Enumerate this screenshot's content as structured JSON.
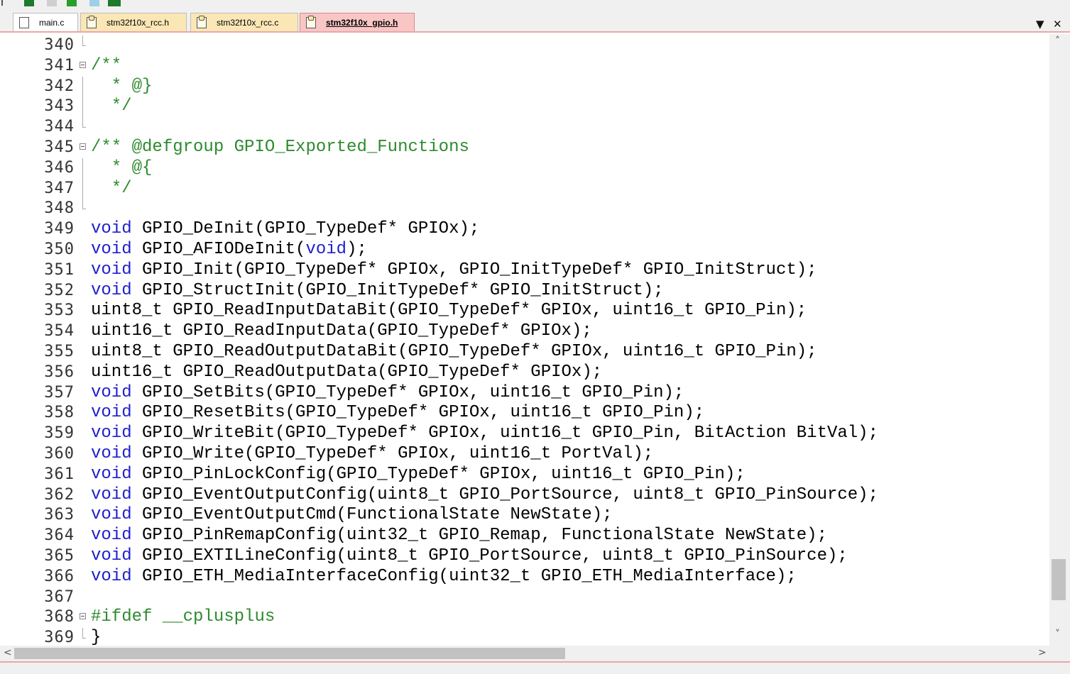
{
  "tabs": [
    {
      "label": "main.c",
      "kind": "source",
      "active": false
    },
    {
      "label": "stm32f10x_rcc.h",
      "kind": "header",
      "active": false
    },
    {
      "label": "stm32f10x_rcc.c",
      "kind": "header",
      "active": false
    },
    {
      "label": "stm32f10x_gpio.h",
      "kind": "header",
      "active": true
    }
  ],
  "tab_controls": {
    "dropdown": "▼",
    "close": "✕"
  },
  "scroll": {
    "up": "˄",
    "down": "˅",
    "left": "<",
    "right": ">",
    "vertical_position_pct": 92,
    "horizontal_thumb_fraction": 0.53
  },
  "colors": {
    "keyword": "#1f1fd0",
    "comment": "#2e8b2e",
    "active_tab": "#f9c6c6",
    "header_tab": "#fbe7b6"
  },
  "lines": [
    {
      "n": "340",
      "fold": "tick",
      "text": ""
    },
    {
      "n": "341",
      "fold": "box",
      "text": "/**",
      "cls": "cm"
    },
    {
      "n": "342",
      "fold": "line",
      "text": "  * @}",
      "cls": "cm"
    },
    {
      "n": "343",
      "fold": "line",
      "text": "  */",
      "cls": "cm"
    },
    {
      "n": "344",
      "fold": "tick",
      "text": ""
    },
    {
      "n": "345",
      "fold": "box",
      "text": "/** @defgroup GPIO_Exported_Functions",
      "cls": "cm"
    },
    {
      "n": "346",
      "fold": "line",
      "text": "  * @{",
      "cls": "cm"
    },
    {
      "n": "347",
      "fold": "line",
      "text": "  */",
      "cls": "cm"
    },
    {
      "n": "348",
      "fold": "tick",
      "text": ""
    },
    {
      "n": "349",
      "fold": "none",
      "kw": "void",
      "text": " GPIO_DeInit(GPIO_TypeDef* GPIOx);"
    },
    {
      "n": "350",
      "fold": "none",
      "kw": "void",
      "text": " GPIO_AFIODeInit(",
      "kw2": "void",
      "text2": ");"
    },
    {
      "n": "351",
      "fold": "none",
      "kw": "void",
      "text": " GPIO_Init(GPIO_TypeDef* GPIOx, GPIO_InitTypeDef* GPIO_InitStruct);"
    },
    {
      "n": "352",
      "fold": "none",
      "kw": "void",
      "text": " GPIO_StructInit(GPIO_InitTypeDef* GPIO_InitStruct);"
    },
    {
      "n": "353",
      "fold": "none",
      "text": "uint8_t GPIO_ReadInputDataBit(GPIO_TypeDef* GPIOx, uint16_t GPIO_Pin);"
    },
    {
      "n": "354",
      "fold": "none",
      "text": "uint16_t GPIO_ReadInputData(GPIO_TypeDef* GPIOx);"
    },
    {
      "n": "355",
      "fold": "none",
      "text": "uint8_t GPIO_ReadOutputDataBit(GPIO_TypeDef* GPIOx, uint16_t GPIO_Pin);"
    },
    {
      "n": "356",
      "fold": "none",
      "text": "uint16_t GPIO_ReadOutputData(GPIO_TypeDef* GPIOx);"
    },
    {
      "n": "357",
      "fold": "none",
      "kw": "void",
      "text": " GPIO_SetBits(GPIO_TypeDef* GPIOx, uint16_t GPIO_Pin);"
    },
    {
      "n": "358",
      "fold": "none",
      "kw": "void",
      "text": " GPIO_ResetBits(GPIO_TypeDef* GPIOx, uint16_t GPIO_Pin);"
    },
    {
      "n": "359",
      "fold": "none",
      "kw": "void",
      "text": " GPIO_WriteBit(GPIO_TypeDef* GPIOx, uint16_t GPIO_Pin, BitAction BitVal);"
    },
    {
      "n": "360",
      "fold": "none",
      "kw": "void",
      "text": " GPIO_Write(GPIO_TypeDef* GPIOx, uint16_t PortVal);"
    },
    {
      "n": "361",
      "fold": "none",
      "kw": "void",
      "text": " GPIO_PinLockConfig(GPIO_TypeDef* GPIOx, uint16_t GPIO_Pin);"
    },
    {
      "n": "362",
      "fold": "none",
      "kw": "void",
      "text": " GPIO_EventOutputConfig(uint8_t GPIO_PortSource, uint8_t GPIO_PinSource);"
    },
    {
      "n": "363",
      "fold": "none",
      "kw": "void",
      "text": " GPIO_EventOutputCmd(FunctionalState NewState);"
    },
    {
      "n": "364",
      "fold": "none",
      "kw": "void",
      "text": " GPIO_PinRemapConfig(uint32_t GPIO_Remap, FunctionalState NewState);"
    },
    {
      "n": "365",
      "fold": "none",
      "kw": "void",
      "text": " GPIO_EXTILineConfig(uint8_t GPIO_PortSource, uint8_t GPIO_PinSource);"
    },
    {
      "n": "366",
      "fold": "none",
      "kw": "void",
      "text": " GPIO_ETH_MediaInterfaceConfig(uint32_t GPIO_ETH_MediaInterface);"
    },
    {
      "n": "367",
      "fold": "none",
      "text": ""
    },
    {
      "n": "368",
      "fold": "box",
      "text": "#ifdef __cplusplus",
      "cls": "pp"
    },
    {
      "n": "369",
      "fold": "tick",
      "text": "}"
    }
  ]
}
